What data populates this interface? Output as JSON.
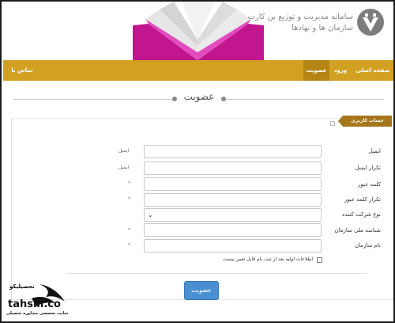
{
  "header": {
    "logo_line1": "سامانه مدیریت و توزیع بن کارت",
    "logo_line2": "سازمان ها و نهادها",
    "logo_line3": "سازمان ها و نهادها"
  },
  "nav": {
    "items": [
      {
        "label": "صفحه اصلی",
        "active": false
      },
      {
        "label": "ورود",
        "active": false
      },
      {
        "label": "عضویت",
        "active": true
      }
    ],
    "contact": "تماس با ما"
  },
  "page": {
    "title": "عضویت",
    "section_tab": "حساب کاربری"
  },
  "form": {
    "fields": [
      {
        "label": "ایمیل",
        "type": "text",
        "value": "",
        "hint": "ایمیل"
      },
      {
        "label": "تکرار ایمیل",
        "type": "text",
        "value": "",
        "hint": "ایمیل"
      },
      {
        "label": "کلمه عبور",
        "type": "password",
        "value": "",
        "hint": "*"
      },
      {
        "label": "تکرار کلمه عبور",
        "type": "password",
        "value": "",
        "hint": "*"
      },
      {
        "label": "نوع شرکت کننده",
        "type": "select",
        "value": "",
        "hint": ""
      },
      {
        "label": "شناسه ملی سازمان",
        "type": "text",
        "value": "",
        "hint": "*"
      },
      {
        "label": "نام سازمان",
        "type": "text",
        "value": "",
        "hint": "*"
      }
    ],
    "checkbox_label": "اطلاعات اولیه بعد از ثبت نام قابل تغییر نیست",
    "submit_label": "عضویت"
  },
  "watermark": {
    "brand": "tahsili.co",
    "brand_fa": "تحصیلیکو",
    "tagline": "سایت تخصصی مشاوره تحصیلی"
  },
  "colors": {
    "nav_bg": "#d3a122",
    "nav_active": "#b58514",
    "section_tab": "#a6761d",
    "submit_bg": "#4a8fd1",
    "book_magenta": "#c2168f"
  }
}
